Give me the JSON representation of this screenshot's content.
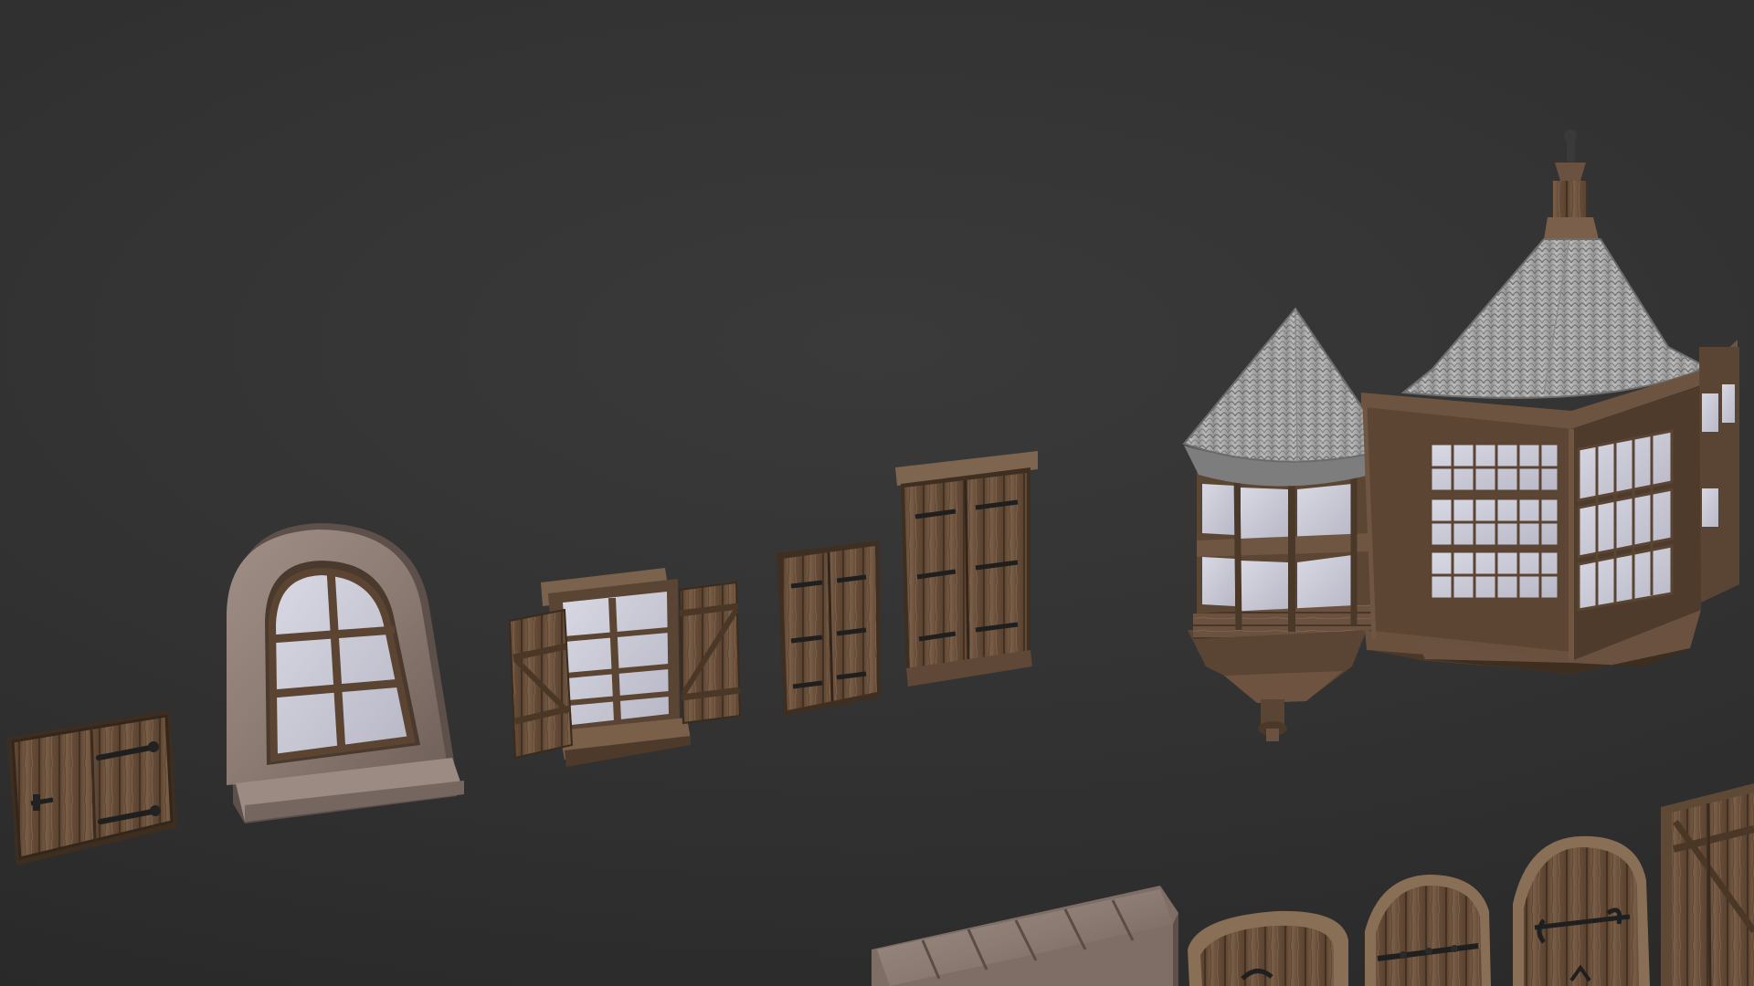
{
  "scene": {
    "description_visible_text": "",
    "background_color": "#333333",
    "wood_color": "#6e5540",
    "wood_dark": "#4a3828",
    "stone_color": "#8f7f78",
    "roof_color": "#a9a9a9",
    "glass_color": "#c9c9d6",
    "iron_color": "#2a2a2a"
  },
  "assets": [
    {
      "id": "small-shutter",
      "kind": "wooden-shutter"
    },
    {
      "id": "arched-stone-window",
      "kind": "stone-arched-window"
    },
    {
      "id": "open-shutter-window",
      "kind": "window-with-open-shutters"
    },
    {
      "id": "closed-double-shutter-small",
      "kind": "closed-double-shutter"
    },
    {
      "id": "closed-double-shutter-tall",
      "kind": "closed-double-shutter"
    },
    {
      "id": "turret-bay-window",
      "kind": "conical-turret-window"
    },
    {
      "id": "hexagonal-bay-tower",
      "kind": "bay-window-tower"
    },
    {
      "id": "stone-lintel",
      "kind": "stone-lintel"
    },
    {
      "id": "arched-door-1",
      "kind": "arched-wooden-door"
    },
    {
      "id": "arched-door-2",
      "kind": "arched-wooden-door"
    },
    {
      "id": "arched-door-3",
      "kind": "arched-wooden-door"
    },
    {
      "id": "plank-door",
      "kind": "braced-plank-door"
    }
  ]
}
